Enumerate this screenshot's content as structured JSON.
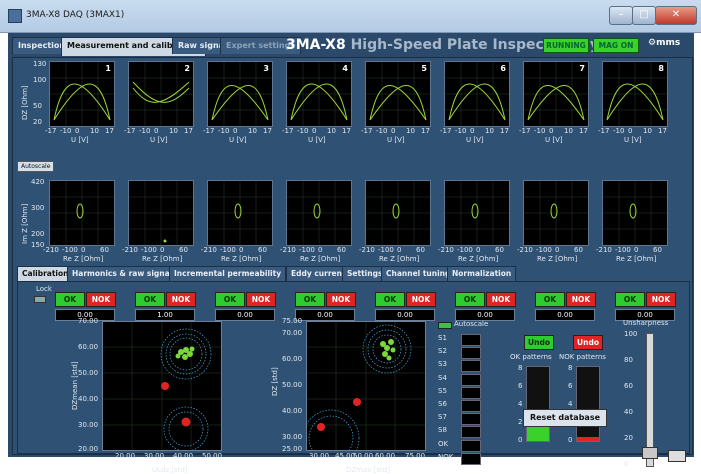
{
  "window": {
    "title": "3MA-X8 DAQ (3MAX1)"
  },
  "top_tabs": [
    "Inspection",
    "Measurement and calibration",
    "Raw signals",
    "Expert settings"
  ],
  "app_title": {
    "main": "3MA-X8",
    "sub": "High-Speed Plate Inspection System"
  },
  "status": {
    "running": "RUNNING",
    "mag_on": "MAG ON",
    "speed": "mms"
  },
  "upper_plots": {
    "ylabel": "DZ [Ohm]",
    "yticks": [
      "130",
      "100",
      "50",
      "20"
    ],
    "xticks": [
      "-17",
      "-10",
      "0",
      "10",
      "17"
    ],
    "xlabel": "U [V]",
    "channels": [
      "1",
      "2",
      "3",
      "4",
      "5",
      "6",
      "7",
      "8"
    ]
  },
  "autoscale_label": "Autoscale",
  "lower_plots": {
    "ylabel": "Im Z [Ohm]",
    "yticks": [
      "420",
      "300",
      "200",
      "150"
    ],
    "xticks": [
      "-210",
      "-100",
      "0",
      "60"
    ],
    "xlabel": "Re Z [Ohm]"
  },
  "bottom_tabs": [
    "Calibration",
    "Harmonics & raw signals",
    "Incremental permeability",
    "Eddy current",
    "Settings",
    "Channel tuning",
    "Normalization"
  ],
  "calibration": {
    "lock_label": "Lock",
    "ok_label": "OK",
    "nok_label": "NOK",
    "channel_values": [
      "0.00",
      "1.00",
      "0.00",
      "0.00",
      "0.00",
      "0.00",
      "0.00",
      "0.00"
    ],
    "plot1": {
      "ylabel": "DZmean [std]",
      "xlabel": "Ucdz [std]",
      "yticks": [
        "70.00",
        "60.00",
        "50.00",
        "40.00",
        "30.00",
        "20.00"
      ],
      "xticks": [
        "20.00",
        "30.00",
        "40.00",
        "50.00"
      ]
    },
    "plot2": {
      "ylabel": "DZ [std]",
      "xlabel": "DZmax [std]",
      "yticks": [
        "75.00",
        "70.00",
        "60.00",
        "50.00",
        "40.00",
        "30.00",
        "25.00"
      ],
      "xticks": [
        "30.00",
        "45.00",
        "50.00",
        "60.00",
        "75.00"
      ]
    },
    "autoscale": "Autoscale",
    "legend": [
      "S1",
      "S2",
      "S3",
      "S4",
      "S5",
      "S6",
      "S7",
      "S8",
      "OK",
      "NOK"
    ],
    "undo_label": "Undo",
    "ok_patterns_label": "OK patterns",
    "nok_patterns_label": "NOK patterns",
    "bar_ticks": [
      "8",
      "6",
      "4",
      "2",
      "0"
    ],
    "ok_patterns_fraction": 0.3,
    "nok_patterns_fraction": 0.06,
    "reset_label": "Reset database",
    "unsharpness_label": "Unsharpness",
    "unsharp_ticks": [
      "100",
      "80",
      "60",
      "40",
      "20",
      "0"
    ],
    "unsharpness_value": 10
  },
  "colors": {
    "ok": "#2ecc2e",
    "nok": "#e02424",
    "curve": "#9bd63a",
    "cluster": "#4aa8e0"
  }
}
